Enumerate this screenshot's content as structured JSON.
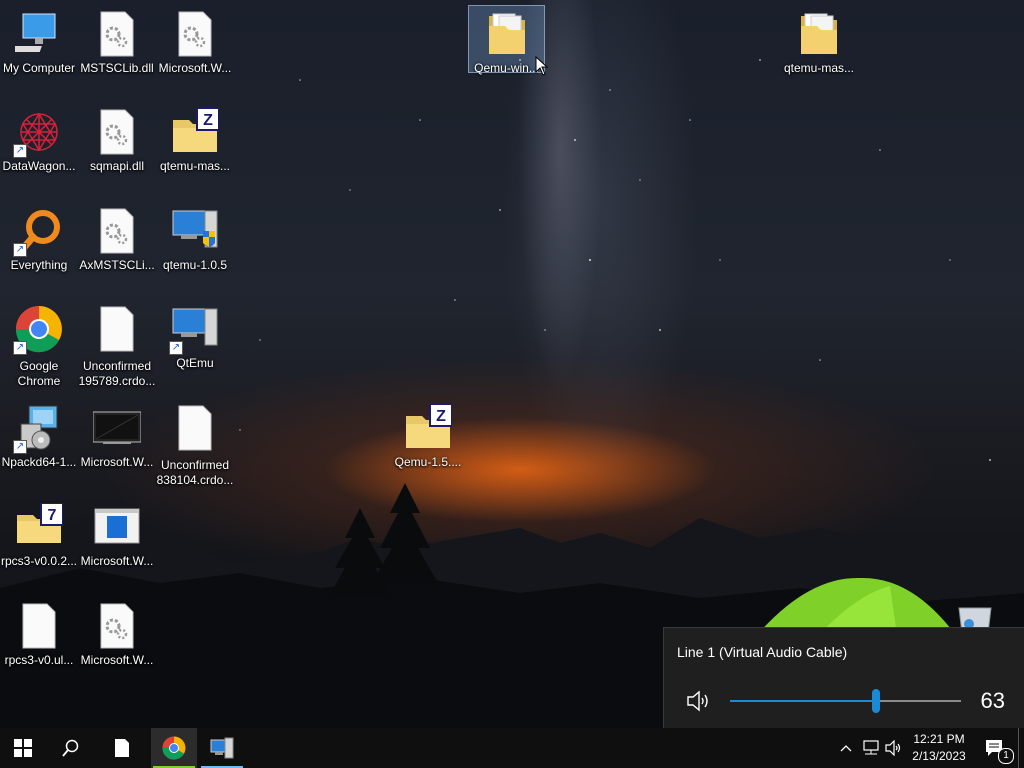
{
  "desktop": {
    "icons": [
      {
        "label": "My Computer"
      },
      {
        "label": "MSTSCLib.dll"
      },
      {
        "label": "Microsoft.W..."
      },
      {
        "label": "Qemu-win..."
      },
      {
        "label": "qtemu-mas..."
      },
      {
        "label": "DataWagon..."
      },
      {
        "label": "sqmapi.dll"
      },
      {
        "label": "qtemu-mas..."
      },
      {
        "label": "Everything"
      },
      {
        "label": "AxMSTSCLi..."
      },
      {
        "label": "qtemu-1.0.5"
      },
      {
        "label": "Google\nChrome",
        "l1": "Google",
        "l2": "Chrome"
      },
      {
        "label": "Unconfirmed 195789.crdo...",
        "l1": "Unconfirmed",
        "l2": "195789.crdo..."
      },
      {
        "label": "QtEmu"
      },
      {
        "label": "Npackd64-1..."
      },
      {
        "label": "Microsoft.W..."
      },
      {
        "label": "Unconfirmed 838104.crdo...",
        "l1": "Unconfirmed",
        "l2": "838104.crdo..."
      },
      {
        "label": "Qemu-1.5...."
      },
      {
        "label": "rpcs3-v0.0.2..."
      },
      {
        "label": "Microsoft.W..."
      },
      {
        "label": "rpcs3-v0.ul..."
      },
      {
        "label": "Microsoft.W..."
      }
    ]
  },
  "volume_flyout": {
    "device": "Line 1 (Virtual Audio Cable)",
    "level": 63
  },
  "taskbar": {
    "time": "12:21 PM",
    "date": "2/13/2023",
    "notification_count": "1"
  },
  "colors": {
    "accent": "#1a8ad4",
    "taskbar": "#0f0f10",
    "flyout": "#1f1f1f"
  }
}
